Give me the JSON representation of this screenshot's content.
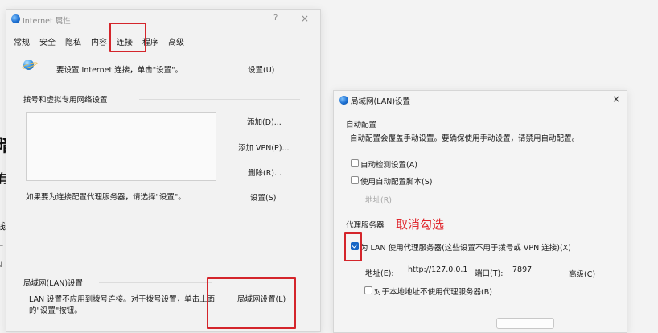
{
  "background_fragments": [
    "暗",
    "有",
    "线",
    "ㄷ",
    "N"
  ],
  "internet_options": {
    "title": "Internet 属性",
    "help": "?",
    "close": "×",
    "tabs": [
      "常规",
      "安全",
      "隐私",
      "内容",
      "连接",
      "程序",
      "高级"
    ],
    "setup_text": "要设置 Internet 连接，单击\"设置\"。",
    "setup_button": "设置(U)",
    "dialup_heading": "拨号和虚拟专用网络设置",
    "add_button": "添加(D)...",
    "add_vpn_button": "添加 VPN(P)...",
    "remove_button": "删除(R)...",
    "settings_button": "设置(S)",
    "proxy_hint": "如果要为连接配置代理服务器，请选择\"设置\"。",
    "lan_heading": "局域网(LAN)设置",
    "lan_desc_line1": "LAN 设置不应用到拨号连接。对于拨号设置，单击上面",
    "lan_desc_line2": "的\"设置\"按钮。",
    "lan_settings_button": "局域网设置(L)"
  },
  "lan_dialog": {
    "title": "局域网(LAN)设置",
    "close": "×",
    "auto_config_heading": "自动配置",
    "auto_config_desc": "自动配置会覆盖手动设置。要确保使用手动设置，请禁用自动配置。",
    "auto_detect_label": "自动检测设置(A)",
    "auto_script_label": "使用自动配置脚本(S)",
    "address_disabled_label": "地址(R)",
    "proxy_heading": "代理服务器",
    "use_proxy_label": "为 LAN 使用代理服务器(这些设置不用于拨号或 VPN 连接)(X)",
    "use_proxy_checked": true,
    "address_label": "地址(E):",
    "address_value": "http://127.0.0.1",
    "port_label": "端口(T):",
    "port_value": "7897",
    "advanced_button": "高级(C)",
    "bypass_local_label": "对于本地地址不使用代理服务器(B)"
  },
  "annotation": {
    "text": "取消勾选",
    "color": "#e0262c"
  },
  "colors": {
    "highlight_box": "#d4252b",
    "checkbox_checked": "#1666c5"
  }
}
